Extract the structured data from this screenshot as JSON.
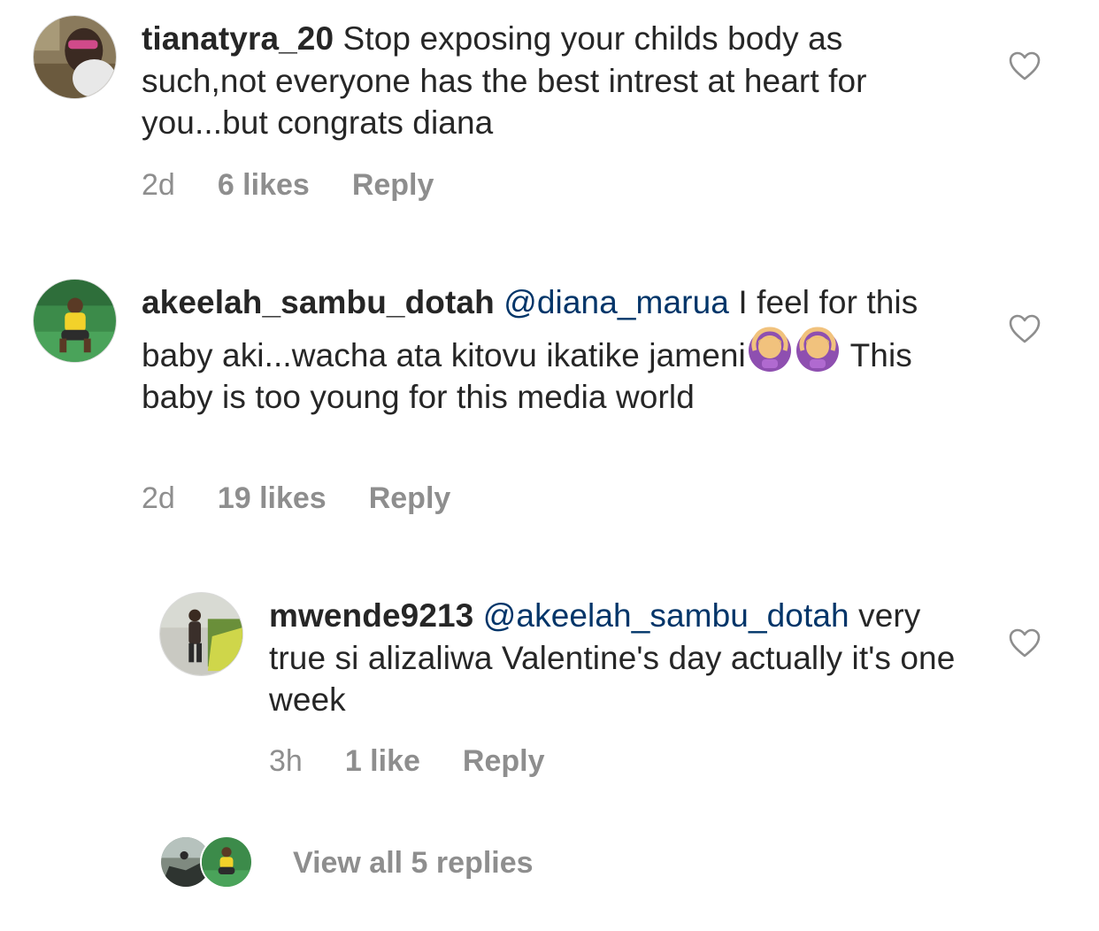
{
  "comments": [
    {
      "username": "tianatyra_20",
      "text": " Stop exposing your childs body as such,not everyone has the best intrest at heart for you...but congrats diana",
      "time": "2d",
      "likes": "6 likes",
      "reply": "Reply",
      "avatar_icon": "profile-photo"
    },
    {
      "username": "akeelah_sambu_dotah",
      "mention": "@diana_marua",
      "text_part1": " I feel for this baby aki...wacha ata kitovu ikatike jameni",
      "text_part2": " This baby is too young for this media world",
      "emoji": "person-gesturing-ok-emoji",
      "time": "2d",
      "likes": "19 likes",
      "reply": "Reply",
      "avatar_icon": "profile-photo"
    },
    {
      "username": "mwende9213",
      "mention": "@akeelah_sambu_dotah",
      "text": " very true  si alizaliwa  Valentine's day actually it's one week",
      "time": "3h",
      "likes": "1 like",
      "reply": "Reply",
      "avatar_icon": "profile-photo"
    }
  ],
  "view_all_replies": "View all 5 replies",
  "colors": {
    "text": "#262626",
    "meta": "#8e8e8e",
    "mention": "#003569",
    "background": "#ffffff"
  },
  "icons": {
    "like": "heart-outline-icon"
  }
}
